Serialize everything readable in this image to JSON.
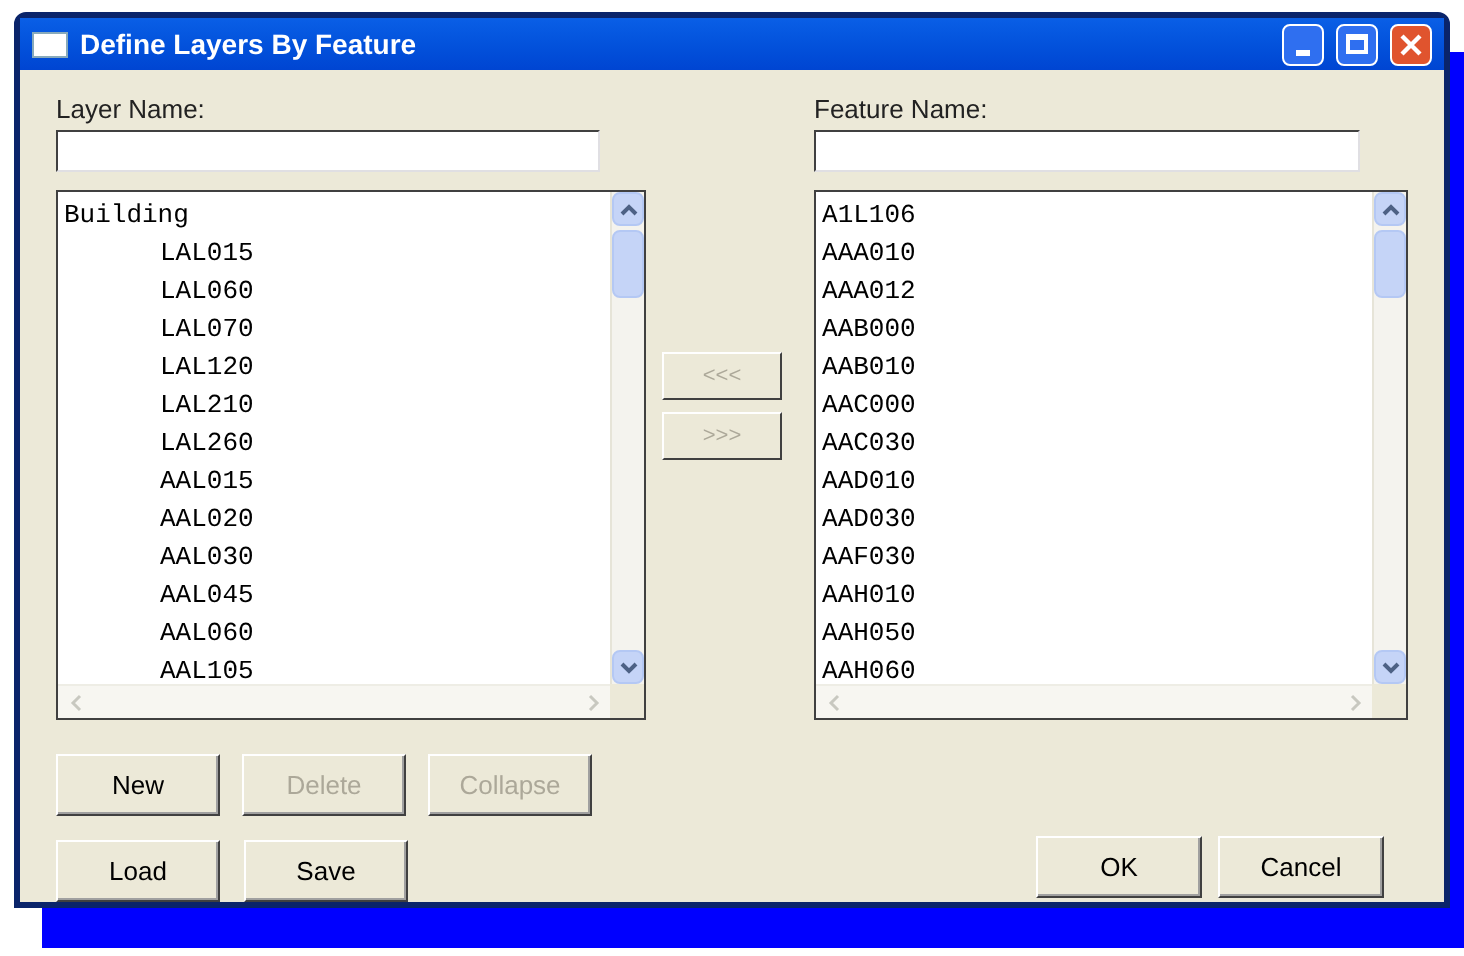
{
  "window": {
    "title": "Define Layers By Feature"
  },
  "layer_name": {
    "label": "Layer Name:"
  },
  "layer_tree": [
    {
      "label": "Building",
      "children": [
        {
          "label": "LAL015"
        },
        {
          "label": "LAL060"
        },
        {
          "label": "LAL070"
        },
        {
          "label": "LAL120"
        },
        {
          "label": "LAL210"
        },
        {
          "label": "LAL260"
        },
        {
          "label": "AAL015"
        },
        {
          "label": "AAL020"
        },
        {
          "label": "AAL030"
        },
        {
          "label": "AAL045"
        },
        {
          "label": "AAL060"
        },
        {
          "label": "AAL105"
        }
      ]
    }
  ],
  "transfer_buttons": [
    {
      "label": "<<<",
      "disabled": true
    },
    {
      "label": ">>>",
      "disabled": true
    }
  ],
  "feature_name": {
    "label": "Feature Name:"
  },
  "feature_list": [
    "A1L106",
    "AAA010",
    "AAA012",
    "AAB000",
    "AAB010",
    "AAC000",
    "AAC030",
    "AAD010",
    "AAD030",
    "AAF030",
    "AAH010",
    "AAH050",
    "AAH060"
  ],
  "layer_buttons": [
    {
      "label": "New",
      "disabled": false
    },
    {
      "label": "Delete",
      "disabled": true
    },
    {
      "label": "Collapse",
      "disabled": true
    }
  ],
  "file_buttons": [
    {
      "label": "Load",
      "disabled": false
    },
    {
      "label": "Save",
      "disabled": false
    }
  ],
  "dialog_buttons": [
    {
      "label": "OK",
      "disabled": false
    },
    {
      "label": "Cancel",
      "disabled": false
    }
  ]
}
